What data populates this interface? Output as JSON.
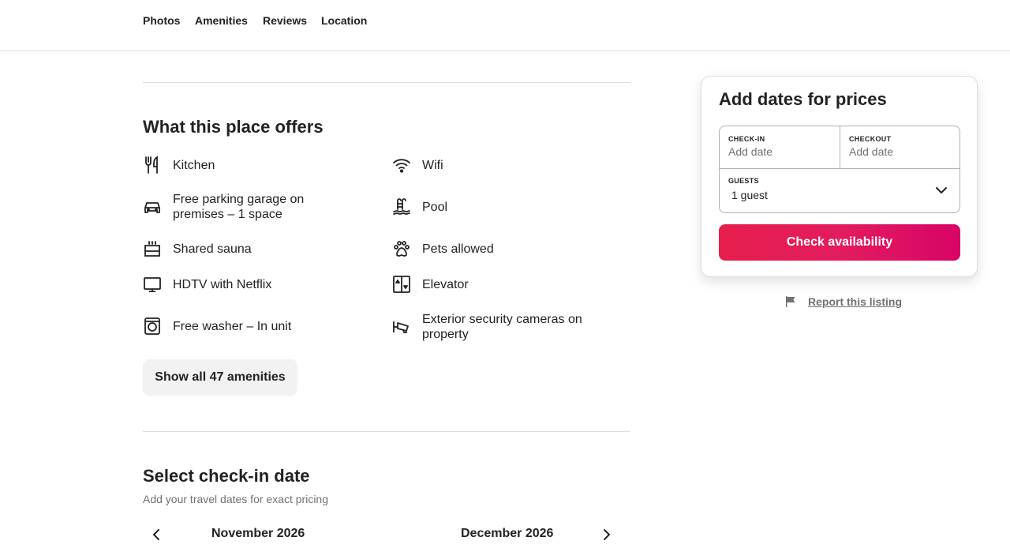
{
  "nav": {
    "tabs": [
      "Photos",
      "Amenities",
      "Reviews",
      "Location"
    ]
  },
  "amenities": {
    "title": "What this place offers",
    "left": [
      {
        "icon": "kitchen-utensils-icon",
        "label": "Kitchen"
      },
      {
        "icon": "car-icon",
        "label": "Free parking garage on premises – 1 space"
      },
      {
        "icon": "sauna-icon",
        "label": "Shared sauna"
      },
      {
        "icon": "tv-icon",
        "label": "HDTV with Netflix"
      },
      {
        "icon": "washer-icon",
        "label": "Free washer – In unit"
      }
    ],
    "right": [
      {
        "icon": "wifi-icon",
        "label": "Wifi"
      },
      {
        "icon": "pool-icon",
        "label": "Pool"
      },
      {
        "icon": "paw-icon",
        "label": "Pets allowed"
      },
      {
        "icon": "elevator-icon",
        "label": "Elevator"
      },
      {
        "icon": "security-camera-icon",
        "label": "Exterior security cameras on property"
      }
    ],
    "show_all_label": "Show all 47 amenities"
  },
  "calendar": {
    "title": "Select check-in date",
    "subtitle": "Add your travel dates for exact pricing",
    "months": [
      "November 2026",
      "December 2026"
    ]
  },
  "booking": {
    "title": "Add dates for prices",
    "checkin_label": "CHECK-IN",
    "checkin_value": "Add date",
    "checkout_label": "CHECKOUT",
    "checkout_value": "Add date",
    "guests_label": "GUESTS",
    "guests_value": "1 guest",
    "cta_label": "Check availability",
    "accent": "#e31c5f"
  },
  "report": {
    "label": "Report this listing"
  }
}
